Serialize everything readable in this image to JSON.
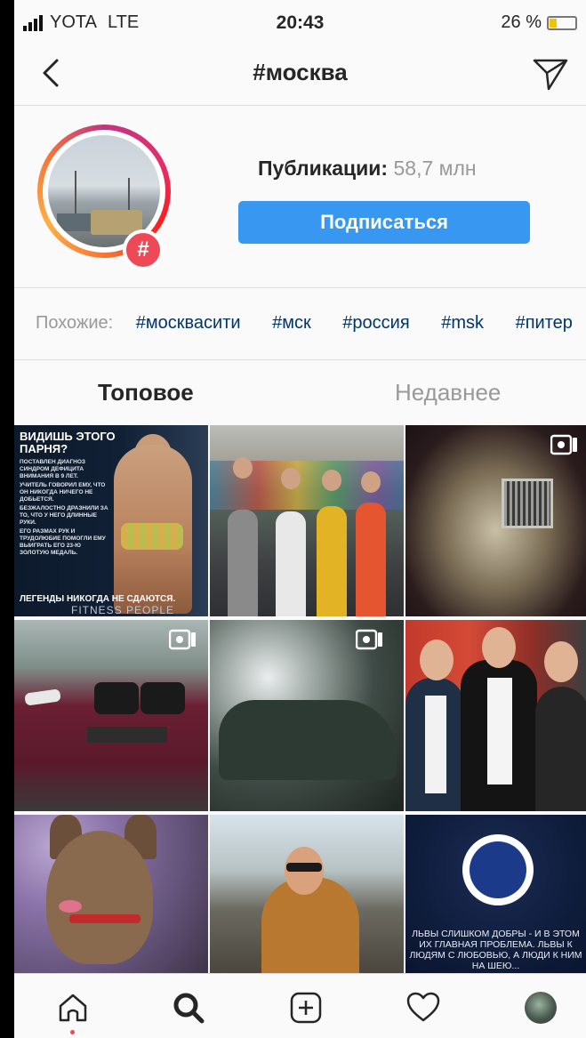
{
  "status_bar": {
    "carrier": "YOTA",
    "network": "LTE",
    "time": "20:43",
    "battery": "26 %",
    "battery_level": 0.26
  },
  "header": {
    "title": "#москва"
  },
  "profile": {
    "posts_label": "Публикации:",
    "posts_count": "58,7 млн",
    "follow_button": "Подписаться",
    "badge_symbol": "#"
  },
  "related": {
    "label": "Похожие:",
    "tags": [
      "#москвасити",
      "#мск",
      "#россия",
      "#msk",
      "#питер"
    ]
  },
  "tabs": {
    "top": "Топовое",
    "recent": "Недавнее"
  },
  "posts": {
    "p1_headline": "ВИДИШЬ ЭТОГО ПАРНЯ?",
    "p1_line1": "ПОСТАВЛЕН ДИАГНОЗ СИНДРОМ ДЕФИЦИТА ВНИМАНИЯ В 9 ЛЕТ.",
    "p1_line2": "УЧИТЕЛЬ ГОВОРИЛ ЕМУ, ЧТО ОН НИКОГДА НИЧЕГО НЕ ДОБЬЕТСЯ.",
    "p1_line3": "БЕЗЖАЛОСТНО ДРАЗНИЛИ ЗА ТО, ЧТО У НЕГО ДЛИННЫЕ РУКИ.",
    "p1_line4": "ЕГО РАЗМАХ РУК И ТРУДОЛЮБИЕ ПОМОГЛИ ЕМУ ВЫИГРАТЬ ЕГО 23-Ю ЗОЛОТУЮ МЕДАЛЬ.",
    "p1_footer": "ЛЕГЕНДЫ НИКОГДА НЕ СДАЮТСЯ.",
    "p1_brand": "FITNESS PEOPLE",
    "p9_text": "ЛЬВЫ СЛИШКОМ ДОБРЫ - И В ЭТОМ ИХ ГЛАВНАЯ ПРОБЛЕМА. ЛЬВЫ К ЛЮДЯМ С ЛЮБОВЬЮ, А ЛЮДИ К НИМ НА ШЕЮ..."
  },
  "bottom_nav": [
    "home-icon",
    "search-icon",
    "add-post-icon",
    "heart-icon",
    "profile-avatar"
  ],
  "colors": {
    "accent": "#3897f0",
    "tag_link": "#003569",
    "badge": "#ed4956"
  }
}
